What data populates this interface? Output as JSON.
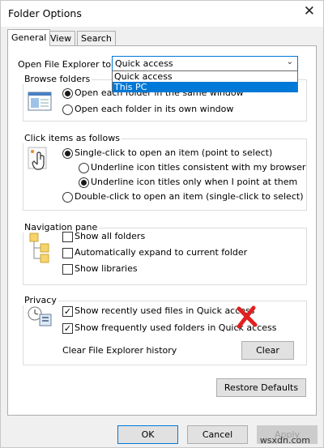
{
  "window": {
    "title": "Folder Options"
  },
  "tabs": [
    "General",
    "View",
    "Search"
  ],
  "open_explorer": {
    "label": "Open File Explorer to:",
    "value": "Quick access",
    "options": [
      "Quick access",
      "This PC"
    ],
    "highlighted": "This PC"
  },
  "browse": {
    "title": "Browse folders",
    "options": [
      "Open each folder in the same window",
      "Open each folder in its own window"
    ]
  },
  "click_items": {
    "title": "Click items as follows",
    "single": "Single-click to open an item (point to select)",
    "underline_browser": "Underline icon titles consistent with my browser",
    "underline_point": "Underline icon titles only when I point at them",
    "double": "Double-click to open an item (single-click to select)"
  },
  "nav_pane": {
    "title": "Navigation pane",
    "options": [
      "Show all folders",
      "Automatically expand to current folder",
      "Show libraries"
    ]
  },
  "privacy": {
    "title": "Privacy",
    "recent_files": "Show recently used files in Quick access",
    "frequent_folders": "Show frequently used folders in Quick access",
    "clear_history": "Clear File Explorer history",
    "clear_button": "Clear"
  },
  "buttons": {
    "restore": "Restore Defaults",
    "ok": "OK",
    "cancel": "Cancel",
    "apply": "Apply"
  },
  "watermark": "wsxdn.com",
  "colors": {
    "accent": "#0078d7",
    "red_x": "#e02020"
  }
}
